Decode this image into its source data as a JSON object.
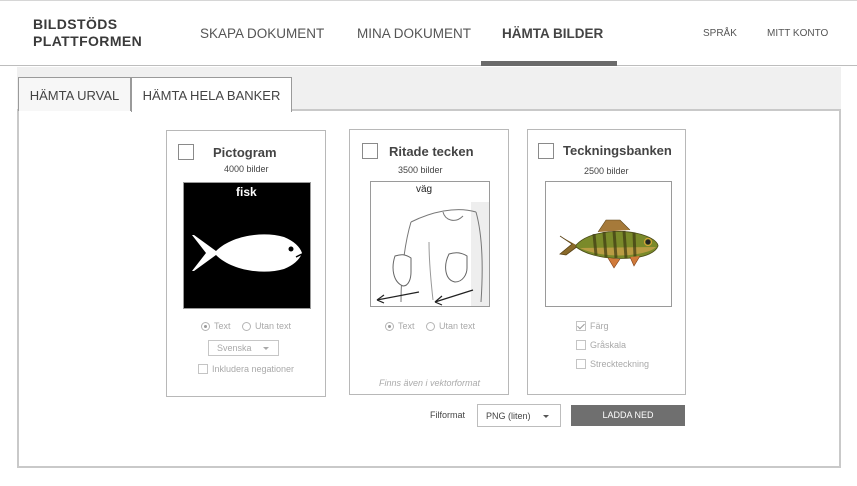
{
  "brand": {
    "line1": "BILDSTÖDS",
    "line2": "PLATTFORMEN"
  },
  "nav": {
    "items": [
      {
        "label": "SKAPA DOKUMENT"
      },
      {
        "label": "MINA DOKUMENT"
      },
      {
        "label": "HÄMTA BILDER",
        "active": true
      }
    ],
    "language": "SPRÅK",
    "account": "MITT KONTO"
  },
  "tabs": [
    {
      "label": "HÄMTA URVAL"
    },
    {
      "label": "HÄMTA HELA BANKER",
      "active": true
    }
  ],
  "cards": {
    "pictogram": {
      "title": "Pictogram",
      "count": "4000 bilder",
      "image_label": "fisk",
      "options": {
        "text": "Text",
        "no_text": "Utan text",
        "selected": "Text"
      },
      "language_select": "Svenska",
      "negations": "Inkludera negationer"
    },
    "ritade": {
      "title": "Ritade tecken",
      "count": "3500 bilder",
      "image_label": "väg",
      "options": {
        "text": "Text",
        "no_text": "Utan text",
        "selected": "Text"
      },
      "note": "Finns även i vektorformat"
    },
    "teckning": {
      "title": "Teckningsbanken",
      "count": "2500 bilder",
      "options": [
        {
          "label": "Färg",
          "checked": true
        },
        {
          "label": "Gråskala",
          "checked": false
        },
        {
          "label": "Streckteckning",
          "checked": false
        }
      ]
    }
  },
  "download": {
    "format_label": "Filformat",
    "format_value": "PNG (liten)",
    "button": "LADDA NED"
  },
  "colors": {
    "accent": "#6f6f6f",
    "panel_border": "#c9c9c9"
  }
}
